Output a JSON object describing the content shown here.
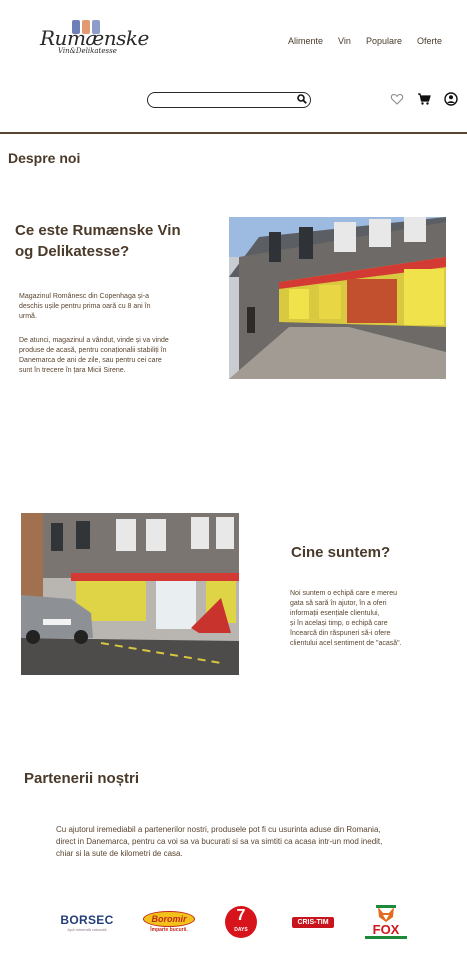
{
  "header": {
    "logo_title": "Rumænske",
    "logo_subtitle": "Vin&Delikatesse",
    "nav": [
      "Alimente",
      "Vin",
      "Populare",
      "Oferte"
    ],
    "search": {
      "placeholder": ""
    }
  },
  "sections": {
    "about_title": "Despre noi",
    "what": {
      "title_line1": "Ce este Rumænske Vin",
      "title_line2": "og Delikatesse?",
      "p1": [
        "Magazinul Românesc din Copenhaga și-a",
        "deschis ușile pentru prima oară cu 8 ani în",
        "urmă."
      ],
      "p2": [
        "De atunci, magazinul a vândut, vinde și va vinde",
        "produse de acasă, pentru conaționalii stabiliți în",
        "Danemarca de ani de zile, sau pentru cei care",
        "sunt în trecere în țara Micii Sirene."
      ]
    },
    "who": {
      "title": "Cine suntem?",
      "p": [
        "Noi suntem o echipă care e mereu",
        "gata să sară în ajutor, în a oferi",
        "informații esențiale clientului,",
        "și în același timp, o echipă care",
        "încearcă din răspuneri să-i ofere",
        "clientului acel sentiment de \"acasă\"."
      ]
    },
    "partners": {
      "title": "Partenerii noștri",
      "p": [
        "Cu ajutorul iremediabil a partenerilor nostri, produsele pot fi cu usurinta aduse din Romania,",
        "direct in Danemarca, pentru ca voi sa va bucurati si sa va simtiti ca acasa intr-un mod inedit,",
        "chiar si la sute de kilometri de casa."
      ],
      "logos": [
        "BORSEC",
        "Boromir",
        "7 DAYS",
        "CRIS-TIM",
        "FOX"
      ],
      "logo_small": {
        "borsec": "Apă minerală naturală",
        "boromir": "Împarte bucurii.",
        "sevendays_num": "7",
        "sevendays_word": "DAYS"
      }
    }
  },
  "colors": {
    "brand_brown": "#5a4530",
    "logo_bar1": "#6f7fb8",
    "logo_bar2": "#e39a72",
    "logo_bar3": "#8e9cc8"
  }
}
